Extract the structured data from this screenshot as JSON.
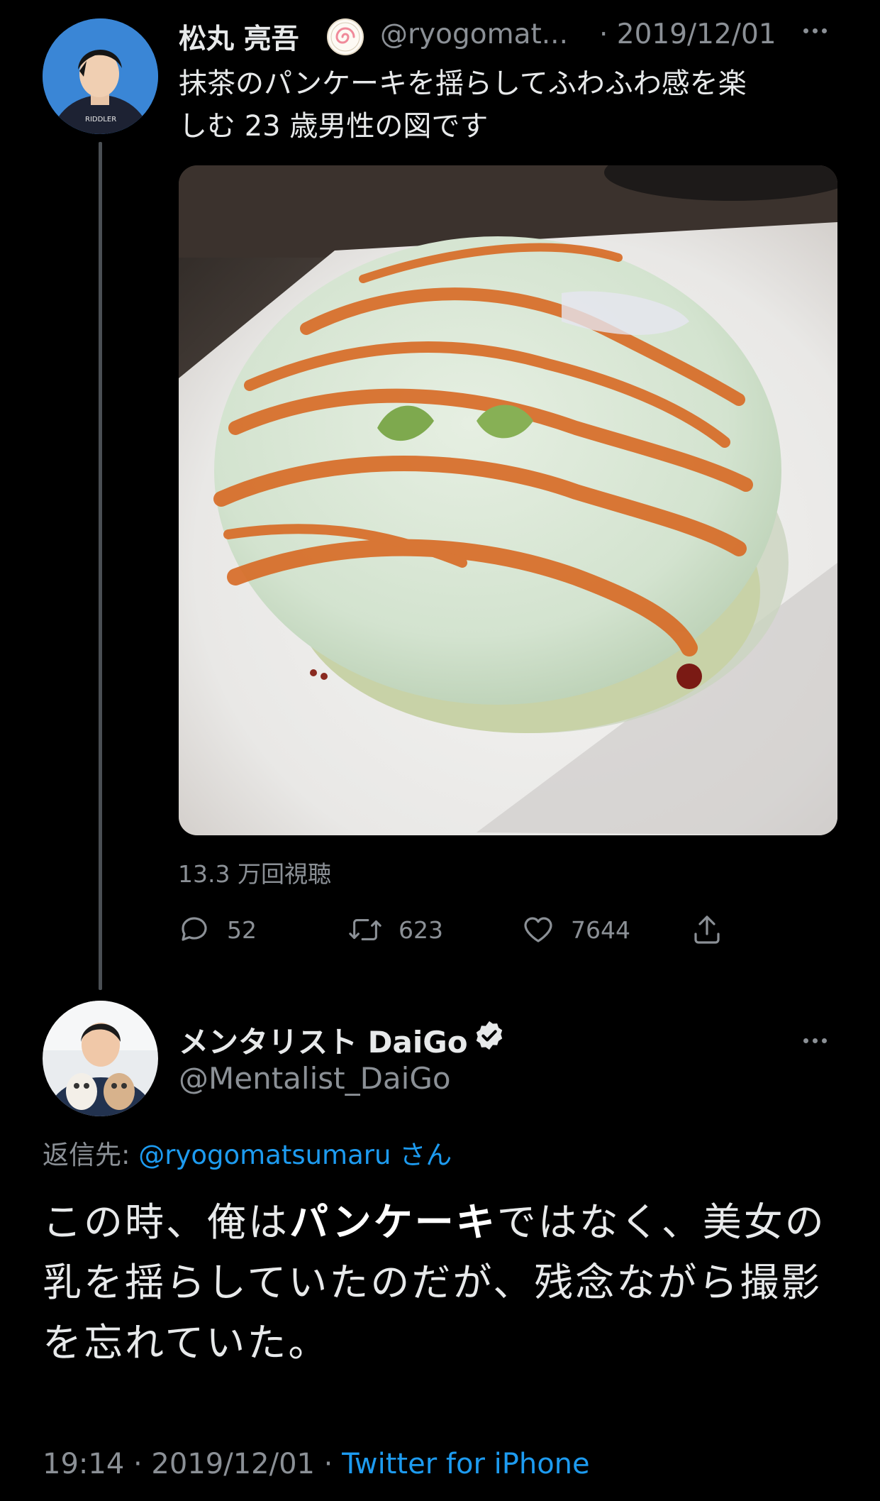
{
  "tweet1": {
    "display_name": "松丸 亮吾",
    "handle": "@ryogomat...",
    "date": "· 2019/12/01",
    "text_line1": "抹茶のパンケーキを揺らしてふわふわ感を楽",
    "text_line2": "しむ 23 歳男性の図です",
    "views": "13.3 万回視聴",
    "actions": {
      "replies": "52",
      "retweets": "623",
      "likes": "7644"
    },
    "avatar_shirt_text": "RIDDLER"
  },
  "tweet2": {
    "display_name": "メンタリスト DaiGo",
    "handle": "@Mentalist_DaiGo",
    "reply_prefix": "返信先: ",
    "reply_handle": "@ryogomatsumaru",
    "reply_suffix": " さん",
    "text_part1": "この時、俺は",
    "text_bold": "パンケーキ",
    "text_part2": "ではなく、美女の乳を揺らしていたのだが、残念ながら撮影を忘れていた。",
    "footer_time": "19:14 · 2019/12/01 · ",
    "footer_source": "Twitter for iPhone"
  },
  "colors": {
    "background": "#000000",
    "link": "#1d9bf0",
    "muted": "#8b9096",
    "text": "#e7e9ea"
  }
}
